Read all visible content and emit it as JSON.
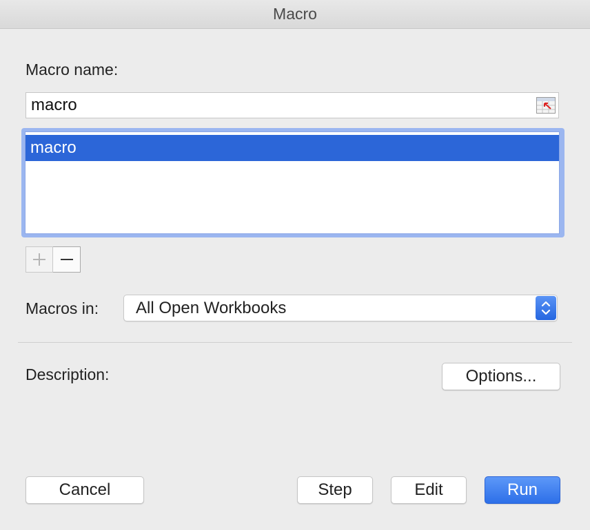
{
  "window": {
    "title": "Macro"
  },
  "macro_name": {
    "label": "Macro name:",
    "value": "macro",
    "range_button_icon": "cell-range-select-icon"
  },
  "macro_list": {
    "items": [
      {
        "label": "macro",
        "selected": true
      }
    ]
  },
  "list_controls": {
    "add_icon": "plus-icon",
    "remove_icon": "minus-icon"
  },
  "macros_in": {
    "label": "Macros in:",
    "selected": "All Open Workbooks",
    "icon": "up-down-chevron-icon"
  },
  "description": {
    "label": "Description:"
  },
  "buttons": {
    "options": "Options...",
    "cancel": "Cancel",
    "step": "Step",
    "edit": "Edit",
    "run": "Run"
  },
  "colors": {
    "accent": "#2c66d8",
    "primary_button": "#2d6fe8",
    "window_bg": "#ececec"
  }
}
